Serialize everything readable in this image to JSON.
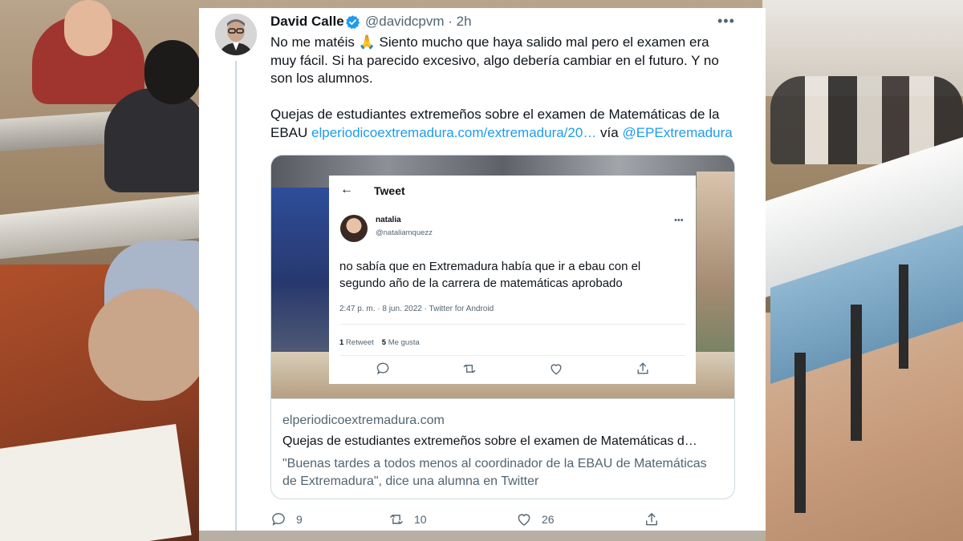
{
  "tweet": {
    "author_name": "David Calle",
    "handle": "@davidcpvm",
    "dot": "·",
    "time": "2h",
    "more": "•••",
    "text_line1": "No me matéis 🙏 Siento mucho que haya salido mal pero el examen era",
    "text_line2": "muy fácil. Si ha parecido excesivo, algo debería cambiar en el futuro. Y no",
    "text_line3": "son los alumnos.",
    "text_line4": "Quejas de estudiantes extremeños sobre el examen de Matemáticas de la",
    "text_line5_prefix": "EBAU ",
    "link": "elperiodicoextremadura.com/extremadura/20…",
    "via": " vía ",
    "mention": "@EPExtremadura",
    "replies": "9",
    "retweets": "10",
    "likes": "26"
  },
  "card": {
    "domain": "elperiodicoextremadura.com",
    "title": "Quejas de estudiantes extremeños sobre el examen de Matemáticas d…",
    "description": "\"Buenas tardes a todos menos al coordinador de la EBAU de Matemáticas de Extremadura\", dice una alumna en Twitter"
  },
  "embedded": {
    "back": "←",
    "title": "Tweet",
    "name": "natalia",
    "handle": "@nataliamquezz",
    "more": "•••",
    "body": "no sabía que en Extremadura había que ir a ebau con el segundo año de la carrera de matemáticas aprobado",
    "meta": "2:47 p. m. · 8 jun. 2022 · Twitter for Android",
    "retweets_count": "1",
    "retweets_label": " Retweet",
    "likes_count": "5",
    "likes_label": " Me gusta"
  },
  "colors": {
    "accent": "#1d9bf0",
    "text": "#0f1419",
    "muted": "#536471",
    "border": "#cfd9de"
  }
}
